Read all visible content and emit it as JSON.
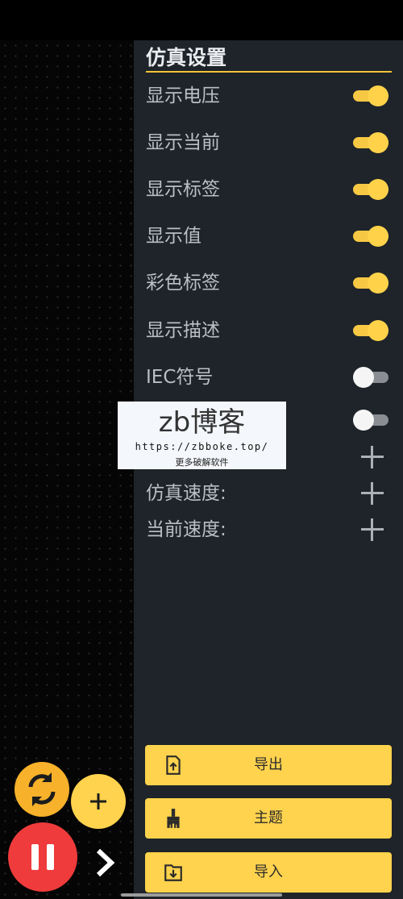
{
  "panel": {
    "title": "仿真设置",
    "toggles": [
      {
        "label": "显示电压",
        "on": true
      },
      {
        "label": "显示当前",
        "on": true
      },
      {
        "label": "显示标签",
        "on": true
      },
      {
        "label": "显示值",
        "on": true
      },
      {
        "label": "彩色标签",
        "on": true
      },
      {
        "label": "显示描述",
        "on": true
      },
      {
        "label": "IEC符号",
        "on": false
      },
      {
        "label": "",
        "on": false
      }
    ],
    "steppers": [
      {
        "label": ""
      },
      {
        "label": "仿真速度:"
      },
      {
        "label": "当前速度:"
      }
    ]
  },
  "actions": {
    "export_label": "导出",
    "theme_label": "主题",
    "import_label": "导入"
  },
  "fabs": {
    "refresh_icon": "refresh-icon",
    "add_icon": "plus-icon",
    "pause_icon": "pause-icon",
    "next_icon": "chevron-right-icon"
  },
  "watermark": {
    "title": "zb博客",
    "url": "https://zbboke.top/",
    "subtitle": "更多破解软件"
  },
  "colors": {
    "accent": "#ffd34d",
    "panel_bg": "#1e2429",
    "pause_red": "#ef3b3b",
    "refresh_orange": "#f7b12a"
  }
}
